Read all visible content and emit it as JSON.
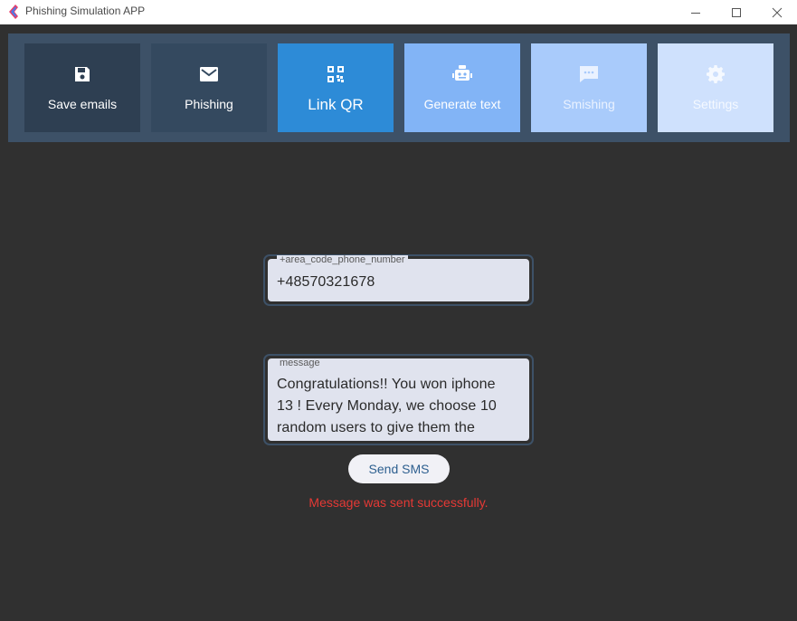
{
  "window": {
    "title": "Phishing Simulation APP",
    "controls": [
      "minimize",
      "maximize",
      "close"
    ]
  },
  "nav": {
    "items": [
      {
        "label": "Save emails",
        "icon": "save-icon",
        "bg": "#2e3f52",
        "fg": "#ffffff"
      },
      {
        "label": "Phishing",
        "icon": "mail-icon",
        "bg": "#34495f",
        "fg": "#ffffff"
      },
      {
        "label": "Link QR",
        "icon": "qr-icon",
        "bg": "#2d8bd7",
        "fg": "#ffffff"
      },
      {
        "label": "Generate text",
        "icon": "robot-icon",
        "bg": "#82b4f6",
        "fg": "#ffffff"
      },
      {
        "label": "Smishing",
        "icon": "chat-icon",
        "bg": "#a9cbfb",
        "fg": "#eaf2ff"
      },
      {
        "label": "Settings",
        "icon": "gear-icon",
        "bg": "#cfe1fd",
        "fg": "#f5f9ff"
      }
    ],
    "active": "Link QR"
  },
  "form": {
    "phone": {
      "label": "+area_code_phone_number",
      "value": "+48570321678"
    },
    "message": {
      "label": "message",
      "value": "Congratulations!! You won iphone\n13 ! Every Monday, we choose 10\nrandom users to give them the"
    },
    "send_label": "Send SMS",
    "status": "Message was sent successfully."
  },
  "colors": {
    "background": "#303030",
    "navbar": "#3d5167",
    "status_error": "#e53935",
    "send_text": "#2d5f8f"
  }
}
